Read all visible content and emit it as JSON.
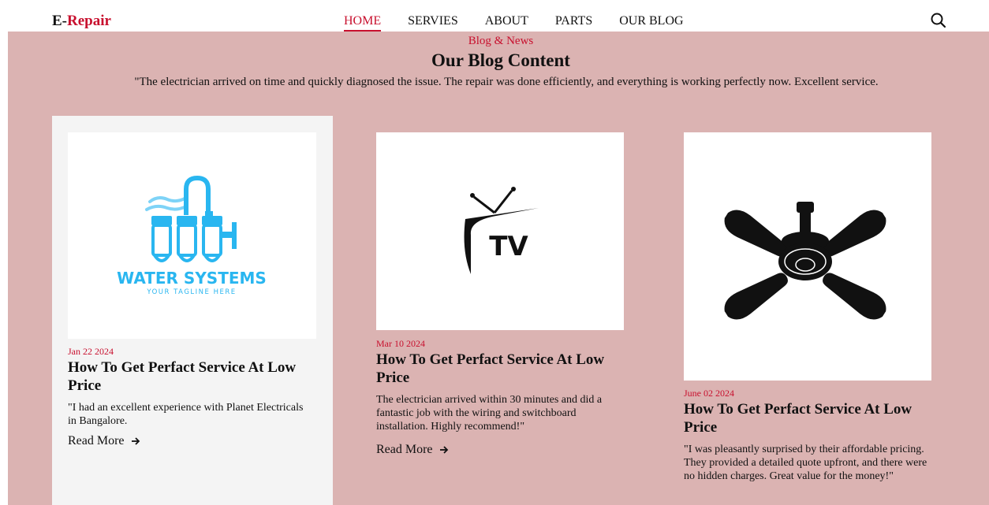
{
  "header": {
    "logo_prefix": "E-",
    "logo_accent": "Repair",
    "nav": [
      {
        "label": "HOME",
        "active": true
      },
      {
        "label": "SERVIES",
        "active": false
      },
      {
        "label": "ABOUT",
        "active": false
      },
      {
        "label": "PARTS",
        "active": false
      },
      {
        "label": "OUR BLOG",
        "active": false
      }
    ],
    "search_icon": "search-icon"
  },
  "blog": {
    "kicker": "Blog & News",
    "title": "Our Blog Content",
    "quote": "\"The electrician arrived on time and quickly diagnosed the issue. The repair was done efficiently, and everything is working perfectly now. Excellent service."
  },
  "cards": [
    {
      "image_icon": "water-systems-logo",
      "image_caption": "WATER SYSTEMS",
      "image_tagline": "YOUR TAGLINE HERE",
      "date": "Jan 22 2024",
      "title": "How To Get Perfact Service At Low Price",
      "text": "\"I had an excellent experience with Planet Electricals in Bangalore.",
      "link": "Read More"
    },
    {
      "image_icon": "tv-icon",
      "image_caption": "TV",
      "date": "Mar 10 2024",
      "title": "How To Get Perfact Service At Low Price",
      "text": "The electrician arrived within 30 minutes and did a fantastic job with the wiring and switchboard installation. Highly recommend!\"",
      "link": "Read More"
    },
    {
      "image_icon": "ceiling-fan-icon",
      "date": "June 02 2024",
      "title": "How To Get Perfact Service At Low Price",
      "text": "\"I was pleasantly surprised by their affordable pricing. They provided a detailed quote upfront, and there were no hidden charges. Great value for the money!\"",
      "link": "Read More"
    }
  ],
  "colors": {
    "accent": "#c8102e",
    "section_bg": "#dbb3b2",
    "card_highlight_bg": "#f4f4f4",
    "water_blue": "#29b6f0"
  }
}
